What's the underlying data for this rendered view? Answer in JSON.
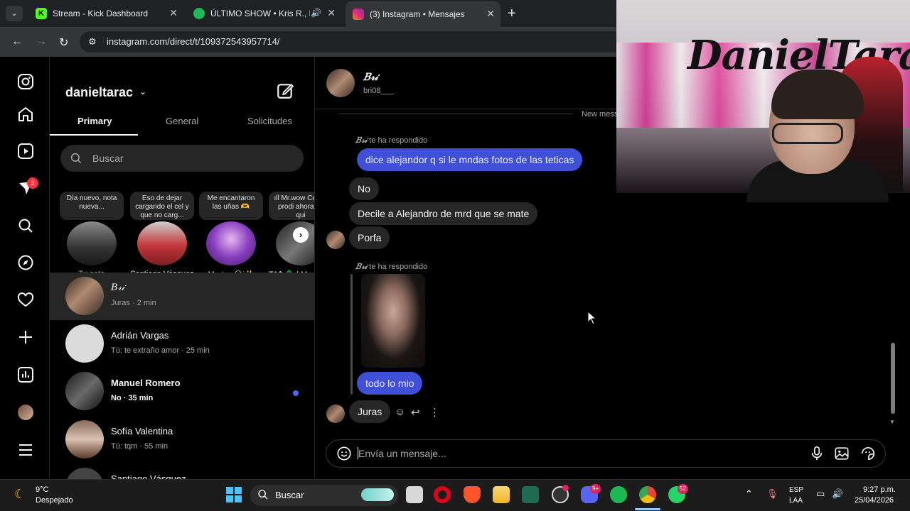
{
  "browser": {
    "tabs": [
      {
        "title": "Stream - Kick Dashboard",
        "favicon_color": "#53fc18"
      },
      {
        "title": "ÚLTIMO SHOW • Kris R., Mé",
        "favicon_color": "#1db954"
      },
      {
        "title": "(3) Instagram • Mensajes",
        "favicon_color": "#e1306c"
      }
    ],
    "url": "instagram.com/direct/t/109372543957714/"
  },
  "sidebar": {
    "notification_count": "3"
  },
  "inbox": {
    "username": "danieltarac",
    "tabs": [
      "Primary",
      "General",
      "Solicitudes"
    ],
    "search_placeholder": "Buscar",
    "notes": [
      {
        "text": "Día nuevo, nota nueva...",
        "name": "Tu nota"
      },
      {
        "text": "Eso de dejar cargando el cel y que no carg...",
        "name": "Santiago Vásquez"
      },
      {
        "text": "Me encantaron las uñas 🫶",
        "name": "Martes 🌕 ✨"
      },
      {
        "text": "ıll Mr.wow Cero*, prodi ahora se qui",
        "name": "TA$ 💲 | Mus"
      }
    ],
    "threads": [
      {
        "name": "𝐵𝓇𝒾",
        "preview": "Juras · 2 min",
        "active": true,
        "unread": false
      },
      {
        "name": "Adrián Vargas",
        "preview": "Tú: te extraño amor · 25 min",
        "active": false,
        "unread": false
      },
      {
        "name": "Manuel Romero",
        "preview": "No · 35 min",
        "active": false,
        "unread": true
      },
      {
        "name": "Sofía Valentina",
        "preview": "Tú: tqm · 55 min",
        "active": false,
        "unread": false
      },
      {
        "name": "Santiago Vásquez",
        "preview": "",
        "active": false,
        "unread": false
      }
    ]
  },
  "conversation": {
    "name": "𝐵𝓇𝒾",
    "handle": "bri08___",
    "new_messages_label": "New mess",
    "replied_label_name": "𝐵𝓇𝒾",
    "replied_label_text": "te ha respondido",
    "messages": [
      {
        "text": "dice alejandor q si le mndas fotos de las teticas",
        "from": "me"
      },
      {
        "text": "No",
        "from": "them"
      },
      {
        "text": "Decile a Alejandro de mrd que se mate",
        "from": "them"
      },
      {
        "text": "Porfa",
        "from": "them"
      },
      {
        "text": "todo lo mio",
        "from": "me"
      },
      {
        "text": "Juras",
        "from": "them"
      }
    ],
    "composer_placeholder": "Envía un mensaje..."
  },
  "webcam": {
    "graffiti_text": "DanielTara"
  },
  "taskbar": {
    "weather_temp": "9°C",
    "weather_desc": "Despejado",
    "search_placeholder": "Buscar",
    "discord_badge": "9+",
    "whatsapp_badge": "52",
    "lang_1": "ESP",
    "lang_2": "LAA",
    "time": "9:27 p.m.",
    "date": "25/04/2026"
  }
}
